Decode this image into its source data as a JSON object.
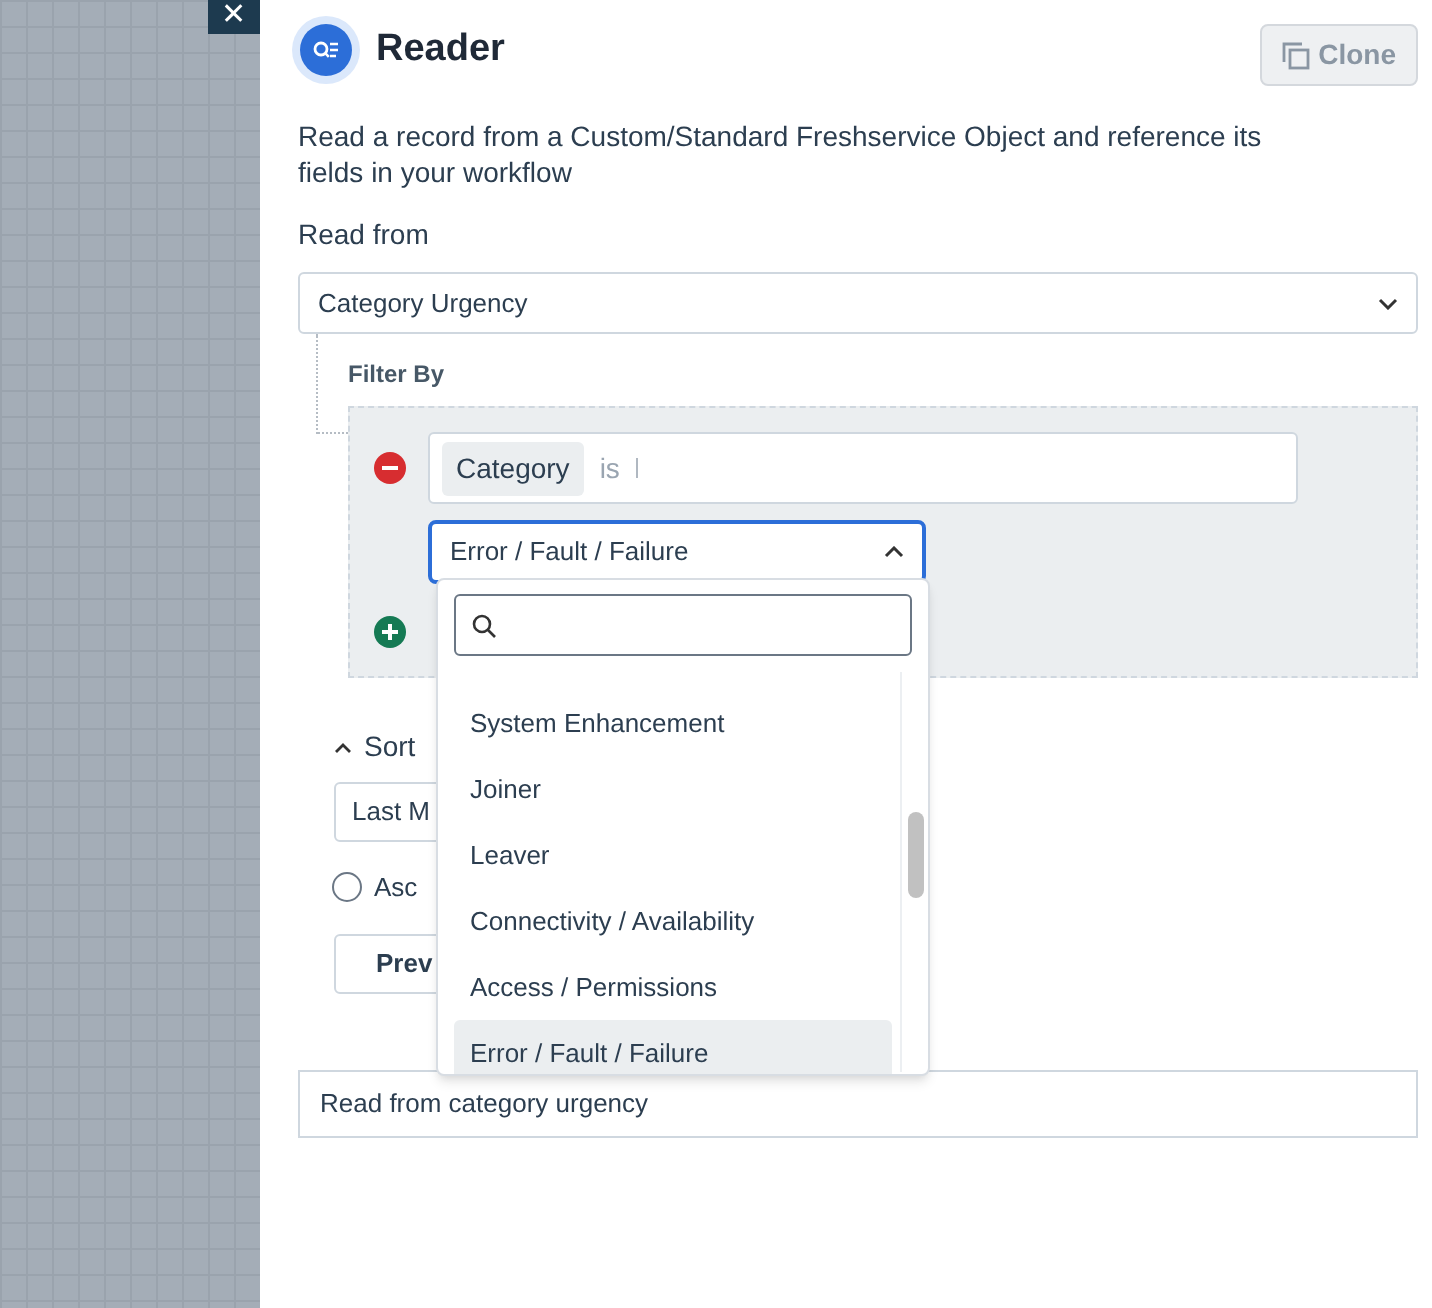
{
  "close_button": {
    "label": "✕"
  },
  "header": {
    "title": "Reader",
    "clone_button": "Clone"
  },
  "description": "Read a record from a Custom/Standard Freshservice Object and reference its fields in your workflow",
  "read_from": {
    "label": "Read from",
    "value": "Category Urgency"
  },
  "filter": {
    "label": "Filter By",
    "conditions": [
      {
        "field": "Category",
        "operator": "is",
        "value": "Error / Fault / Failure",
        "expanded": true
      }
    ],
    "dropdown": {
      "items": [
        {
          "label": "System Enhancement",
          "selected": false
        },
        {
          "label": "Joiner",
          "selected": false
        },
        {
          "label": "Leaver",
          "selected": false
        },
        {
          "label": "Connectivity / Availability",
          "selected": false
        },
        {
          "label": "Access / Permissions",
          "selected": false
        },
        {
          "label": "Error / Fault / Failure",
          "selected": true
        }
      ]
    }
  },
  "sort": {
    "label": "Sort",
    "expanded": true,
    "field_value": "Last M",
    "order_option": {
      "label": "Asc",
      "selected": false
    }
  },
  "preview_button": "Prev",
  "name_field": {
    "value": "Read from category urgency"
  }
}
